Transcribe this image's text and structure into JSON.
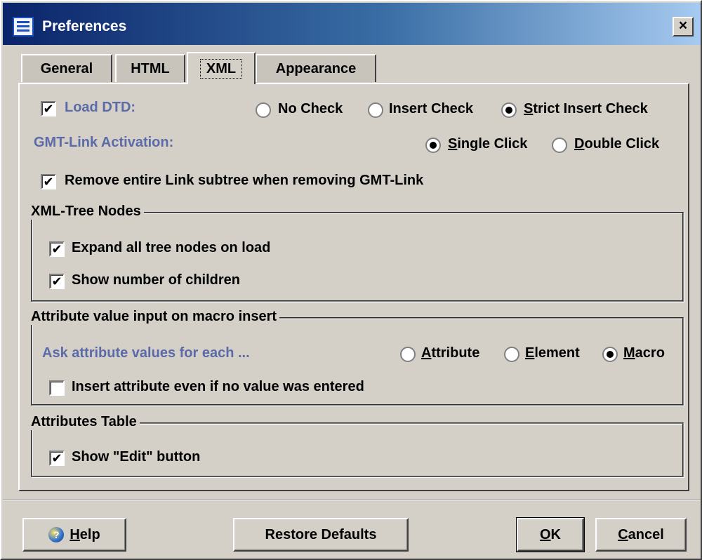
{
  "window": {
    "title": "Preferences",
    "close_glyph": "×",
    "icon": "preferences-app-icon"
  },
  "tabs": [
    {
      "label": "General",
      "active": false
    },
    {
      "label": "HTML",
      "active": false
    },
    {
      "label": "XML",
      "active": true
    },
    {
      "label": "Appearance",
      "active": false
    }
  ],
  "xml": {
    "load_dtd": {
      "label": "Load DTD:",
      "checked": true
    },
    "dtd_options": [
      {
        "label": "No Check",
        "selected": false
      },
      {
        "label": "Insert Check",
        "selected": false
      },
      {
        "label": "Strict Insert Check",
        "selected": true,
        "mnemonic": "S",
        "rest": "trict Insert Check"
      }
    ],
    "gmt_link_label": "GMT-Link Activation:",
    "gmt_options": [
      {
        "label": "Single Click",
        "selected": true,
        "mnemonic": "S",
        "rest": "ingle Click"
      },
      {
        "label": "Double Click",
        "selected": false,
        "mnemonic": "D",
        "rest": "ouble Click"
      }
    ],
    "remove_subtree": {
      "label": "Remove entire Link subtree when removing GMT-Link",
      "checked": true
    },
    "tree_nodes": {
      "title": "XML-Tree Nodes",
      "expand_all": {
        "label": "Expand all tree nodes on load",
        "checked": true
      },
      "show_children": {
        "label": "Show number of children",
        "checked": true
      }
    },
    "attr_input": {
      "title": "Attribute value input on macro insert",
      "ask_label": "Ask attribute values for each ...",
      "options": [
        {
          "label": "Attribute",
          "selected": false,
          "mnemonic": "A",
          "rest": "ttribute"
        },
        {
          "label": "Element",
          "selected": false,
          "mnemonic": "E",
          "rest": "lement"
        },
        {
          "label": "Macro",
          "selected": true,
          "mnemonic": "M",
          "rest": "acro"
        }
      ],
      "insert_even_if_empty": {
        "label": "Insert attribute even if no value was entered",
        "checked": false
      }
    },
    "attr_table": {
      "title": "Attributes Table",
      "show_edit": {
        "label": "Show \"Edit\" button",
        "checked": true
      }
    }
  },
  "buttons": {
    "help": {
      "label": "Help",
      "mnemonic": "H",
      "rest": "elp"
    },
    "restore": {
      "label": "Restore Defaults"
    },
    "ok": {
      "label": "OK",
      "mnemonic": "O",
      "rest": "K"
    },
    "cancel": {
      "label": "Cancel",
      "mnemonic": "C",
      "rest": "ancel"
    }
  },
  "check_glyph": "✔",
  "colors": {
    "titlebar_start": "#0a246a",
    "titlebar_end": "#a6caf0",
    "face": "#d4d0c8",
    "blue_label": "#5b6aa8"
  }
}
